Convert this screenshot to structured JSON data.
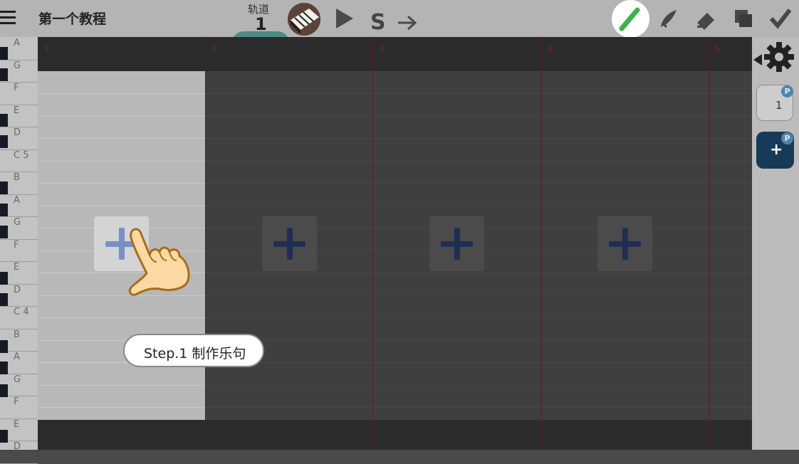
{
  "header": {
    "title": "第一个教程",
    "track_label": "轨道",
    "track_number": "1",
    "s_label": "S"
  },
  "ruler": {
    "measures": [
      "1",
      "2",
      "3",
      "4",
      "5"
    ]
  },
  "piano": {
    "labels": [
      "A",
      "G",
      "F",
      "E",
      "D",
      "C 5",
      "B",
      "A",
      "G",
      "F",
      "E",
      "D",
      "C 4",
      "B",
      "A",
      "G",
      "F",
      "E",
      "D"
    ]
  },
  "tutorial": {
    "step_text": "Step.1 制作乐句"
  },
  "patterns": {
    "slot_1_label": "1",
    "badge_label": "P",
    "add_label": "+"
  },
  "icons": {
    "menu": "menu-icon",
    "play": "play-icon",
    "arrow": "arrow-right-icon",
    "pen": "pen-icon",
    "brush": "brush-icon",
    "eraser": "eraser-icon",
    "copy": "copy-icon",
    "check": "check-icon",
    "settings": "gear-icon",
    "hand": "pointing-hand-icon"
  },
  "colors": {
    "active_tool": "#3cb34a",
    "pattern_add": "#173b57",
    "badge": "#4e86ad",
    "measure_line": "#5a1c1c"
  }
}
